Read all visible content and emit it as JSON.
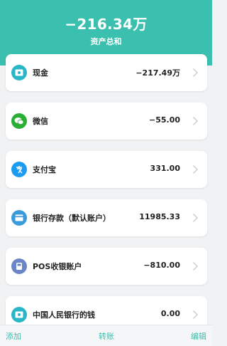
{
  "summary": {
    "total": "−216.34万",
    "label": "资产总和"
  },
  "accounts": [
    {
      "name": "现金",
      "amount": "−217.49万",
      "icon": "cash-icon",
      "color": "#29b6c8"
    },
    {
      "name": "微信",
      "amount": "−55.00",
      "icon": "wechat-icon",
      "color": "#2aae36"
    },
    {
      "name": "支付宝",
      "amount": "331.00",
      "icon": "alipay-icon",
      "color": "#1c9cf0"
    },
    {
      "name": "银行存款（默认账户）",
      "amount": "11985.33",
      "icon": "bank-card-icon",
      "color": "#3a9bdc"
    },
    {
      "name": "POS收银账户",
      "amount": "−810.00",
      "icon": "pos-icon",
      "color": "#6a86c9"
    },
    {
      "name": "中国人民银行的钱",
      "amount": "0.00",
      "icon": "cash-icon",
      "color": "#29b6c8"
    }
  ],
  "footer": {
    "add": "添加",
    "transfer": "转账",
    "edit": "编辑"
  },
  "colors": {
    "accent": "#3bbfae",
    "background": "#f0f2f4"
  }
}
